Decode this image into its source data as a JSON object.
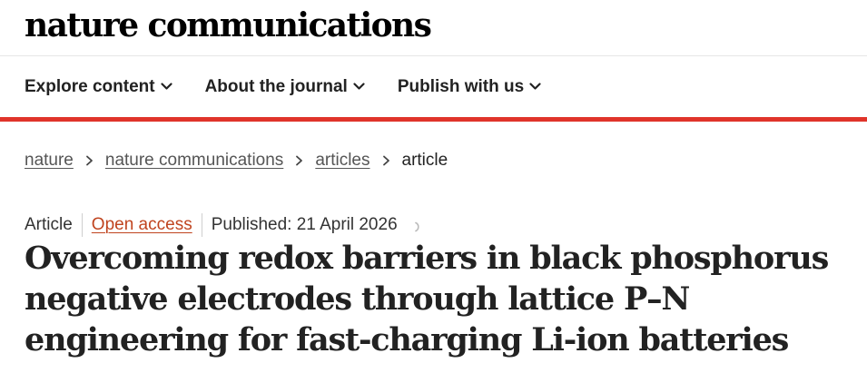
{
  "header": {
    "logo_text": "nature communications"
  },
  "nav": {
    "items": [
      {
        "label": "Explore content"
      },
      {
        "label": "About the journal"
      },
      {
        "label": "Publish with us"
      }
    ]
  },
  "breadcrumb": {
    "items": [
      {
        "label": "nature"
      },
      {
        "label": "nature communications"
      },
      {
        "label": "articles"
      }
    ],
    "current": "article"
  },
  "article": {
    "type": "Article",
    "access": "Open access",
    "published": "Published: 21 April 2026",
    "title": "Overcoming redox barriers in black phosphorus negative electrodes through lattice P–N engineering for fast-charging Li-ion batteries"
  },
  "colors": {
    "accent_red": "#e0342a",
    "open_access": "#c0441f"
  },
  "icons": {
    "nav_dropdown": "chevron-down-icon",
    "breadcrumb_separator": "chevron-right-icon",
    "loading": "spinner-icon"
  }
}
